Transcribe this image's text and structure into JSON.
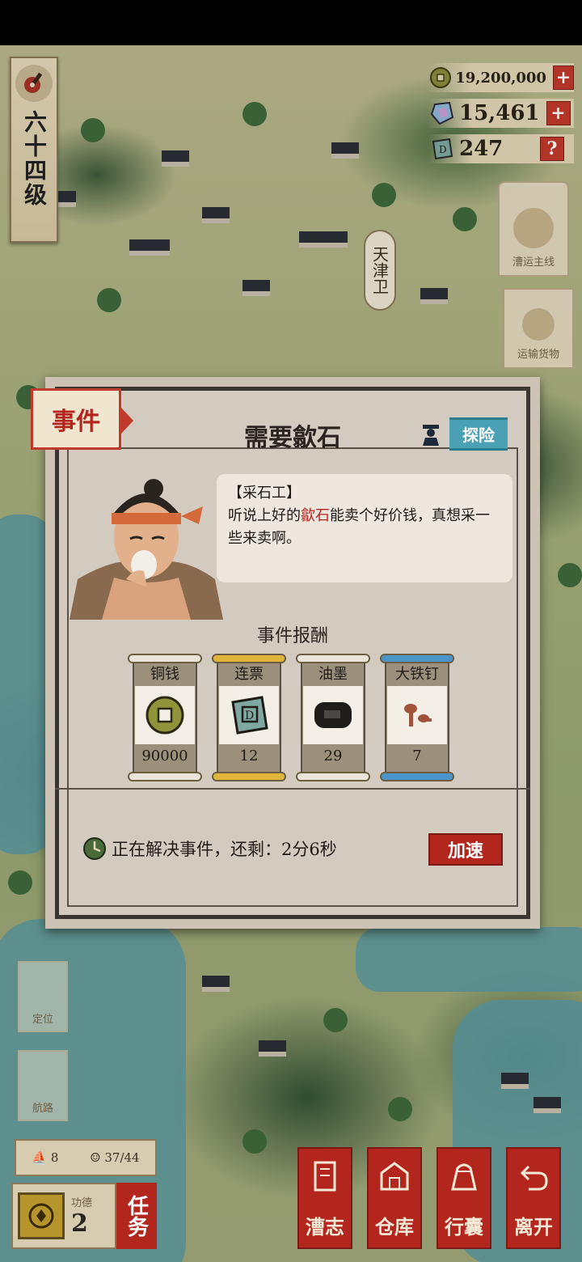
{
  "level": {
    "label": "六十四级"
  },
  "resources": {
    "copper_value": "19,200,000",
    "copper_action": "+",
    "gem_value": "15,461",
    "gem_action": "+",
    "ticket_value": "247",
    "ticket_action": "?"
  },
  "map": {
    "place_label": "天津卫"
  },
  "side_tags": [
    {
      "label": "漕运主线"
    },
    {
      "label": "运输货物"
    }
  ],
  "event": {
    "tag": "事件",
    "title": "需要歙石",
    "explore_label": "探险",
    "speaker": "【采石工】",
    "dialogue_before": "听说上好的",
    "dialogue_highlight": "歙石",
    "dialogue_after": "能卖个好价钱，真想采一些来卖啊。",
    "reward_title": "事件报酬",
    "rewards": [
      {
        "name": "铜钱",
        "qty": "90000",
        "icon": "coin-icon",
        "rod_color": "#ece6da"
      },
      {
        "name": "连票",
        "qty": "12",
        "icon": "ticket-icon",
        "rod_color": "#e0b53a"
      },
      {
        "name": "油墨",
        "qty": "29",
        "icon": "ink-icon",
        "rod_color": "#ece6da"
      },
      {
        "name": "大铁钉",
        "qty": "7",
        "icon": "nail-icon",
        "rod_color": "#4a95c9"
      }
    ],
    "status_text": "正在解决事件，还剩：2分6秒",
    "speed_label": "加速"
  },
  "left_buttons": [
    {
      "label": "定位"
    },
    {
      "label": "航路"
    }
  ],
  "stats": {
    "boats": "8",
    "crew": "37/44"
  },
  "trade": {
    "label": "功德",
    "value": "2"
  },
  "task_label": "任务",
  "nav": [
    {
      "label": "漕志",
      "icon": "book-icon"
    },
    {
      "label": "仓库",
      "icon": "warehouse-icon"
    },
    {
      "label": "行囊",
      "icon": "bag-icon"
    },
    {
      "label": "离开",
      "icon": "return-icon"
    }
  ],
  "colors": {
    "accent_red": "#b3261e",
    "explore_blue": "#4aa0b5",
    "paper": "#d3cbbf"
  }
}
